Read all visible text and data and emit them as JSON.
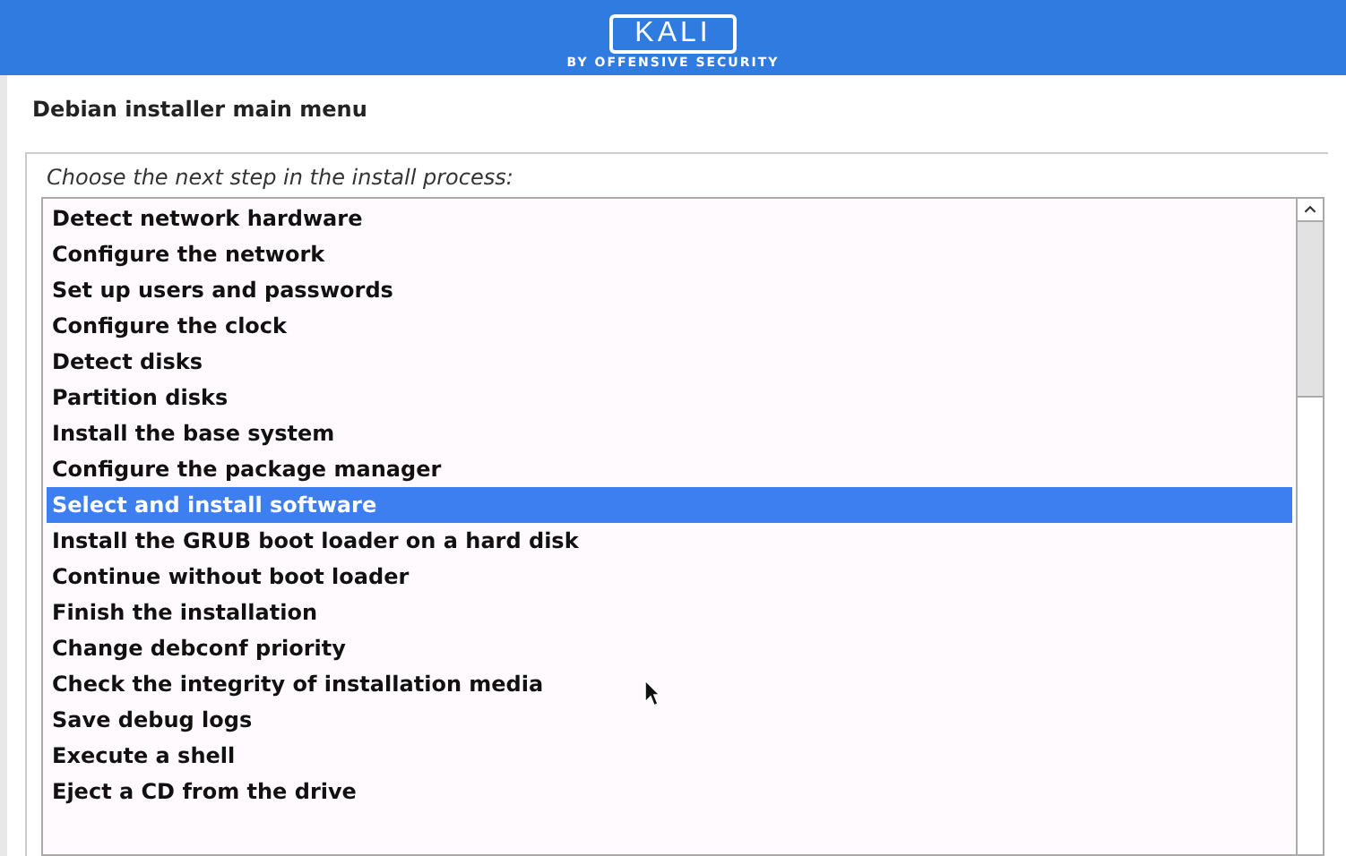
{
  "banner": {
    "logo": "KALI",
    "tagline": "BY OFFENSIVE SECURITY"
  },
  "title": "Debian installer main menu",
  "prompt": "Choose the next step in the install process:",
  "items": [
    {
      "label": "Detect network hardware",
      "selected": false
    },
    {
      "label": "Configure the network",
      "selected": false
    },
    {
      "label": "Set up users and passwords",
      "selected": false
    },
    {
      "label": "Configure the clock",
      "selected": false
    },
    {
      "label": "Detect disks",
      "selected": false
    },
    {
      "label": "Partition disks",
      "selected": false
    },
    {
      "label": "Install the base system",
      "selected": false
    },
    {
      "label": "Configure the package manager",
      "selected": false
    },
    {
      "label": "Select and install software",
      "selected": true
    },
    {
      "label": "Install the GRUB boot loader on a hard disk",
      "selected": false
    },
    {
      "label": "Continue without boot loader",
      "selected": false
    },
    {
      "label": "Finish the installation",
      "selected": false
    },
    {
      "label": "Change debconf priority",
      "selected": false
    },
    {
      "label": "Check the integrity of installation media",
      "selected": false
    },
    {
      "label": "Save debug logs",
      "selected": false
    },
    {
      "label": "Execute a shell",
      "selected": false
    },
    {
      "label": "Eject a CD from the drive",
      "selected": false
    }
  ]
}
